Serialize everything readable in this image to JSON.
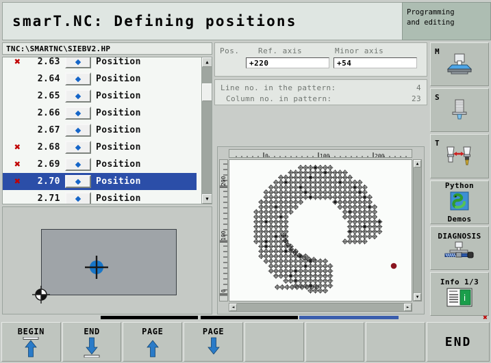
{
  "titlebar": {
    "title": "smarT.NC: Defining positions",
    "mode_line1": "Programming",
    "mode_line2": "and editing"
  },
  "left_panel": {
    "path": "TNC:\\SMARTNC\\SIEBV2.HP",
    "scroll_up_icon": "▲",
    "scroll_down_icon": "▼",
    "rows": [
      {
        "mark": "✖",
        "number": "2.63",
        "label": "Position",
        "selected": false,
        "icon": "position-diamond-icon"
      },
      {
        "mark": "",
        "number": "2.64",
        "label": "Position",
        "selected": false,
        "icon": "position-diamond-icon"
      },
      {
        "mark": "",
        "number": "2.65",
        "label": "Position",
        "selected": false,
        "icon": "position-diamond-icon"
      },
      {
        "mark": "",
        "number": "2.66",
        "label": "Position",
        "selected": false,
        "icon": "position-diamond-icon"
      },
      {
        "mark": "",
        "number": "2.67",
        "label": "Position",
        "selected": false,
        "icon": "position-diamond-icon"
      },
      {
        "mark": "✖",
        "number": "2.68",
        "label": "Position",
        "selected": false,
        "icon": "position-diamond-icon"
      },
      {
        "mark": "✖",
        "number": "2.69",
        "label": "Position",
        "selected": false,
        "icon": "position-diamond-icon"
      },
      {
        "mark": "✖",
        "number": "2.70",
        "label": "Position",
        "selected": true,
        "icon": "position-diamond-icon"
      },
      {
        "mark": "",
        "number": "2.71",
        "label": "Position",
        "selected": false,
        "icon": "position-diamond-icon"
      }
    ]
  },
  "position_panel": {
    "pos_label": "Pos.",
    "ref_axis_label": "Ref. axis",
    "minor_axis_label": "Minor axis",
    "ref_axis_value": "+220",
    "minor_axis_value": "+54"
  },
  "pattern_panel": {
    "line_label": "Line no. in the pattern:",
    "line_value": "4",
    "column_label": "Column no. in pattern:",
    "column_value": "23"
  },
  "graphics": {
    "h_ruler_labels": [
      "0",
      "100",
      "200"
    ],
    "v_ruler_labels": [
      "200",
      "100",
      "0"
    ],
    "marker_color": "#8b1520",
    "scroll_up_icon": "▲",
    "scroll_down_icon": "▼",
    "scroll_left_icon": "◄",
    "scroll_right_icon": "►"
  },
  "softkeys": [
    {
      "label": "M",
      "icon": "spindle-table-icon",
      "label_pos": "corner"
    },
    {
      "label": "S",
      "icon": "spindle-speed-icon",
      "label_pos": "corner"
    },
    {
      "label": "T",
      "icon": "tool-change-icon",
      "label_pos": "corner"
    },
    {
      "label_top": "Python",
      "label_bottom": "Demos",
      "icon": "python-snake-icon",
      "label_pos": "split"
    },
    {
      "label_top": "DIAGNOSIS",
      "icon": "diagnosis-icon",
      "label_pos": "top"
    },
    {
      "label_top": "Info 1/3",
      "icon": "info-document-icon",
      "label_pos": "top"
    }
  ],
  "status_bars": {
    "bar_a_color": "#000000",
    "bar_b_color": "#000000",
    "bar_c_color": "#3a5dad",
    "close_badge": "✖"
  },
  "bottom_keys": [
    {
      "label": "BEGIN",
      "icon": "arrow-up-to-line-icon"
    },
    {
      "label": "END",
      "icon": "arrow-down-to-line-icon"
    },
    {
      "label": "PAGE",
      "icon": "arrow-up-icon"
    },
    {
      "label": "PAGE",
      "icon": "arrow-down-icon"
    },
    {
      "label": "",
      "icon": ""
    },
    {
      "label": "",
      "icon": ""
    },
    {
      "label": "",
      "icon": ""
    }
  ],
  "bottom_end_key": {
    "label": "END"
  },
  "colors": {
    "selection_blue": "#2b4ea8",
    "mark_red": "#c00000",
    "accent_blue": "#1565c8",
    "panel_bg": "#c9cdc9"
  }
}
